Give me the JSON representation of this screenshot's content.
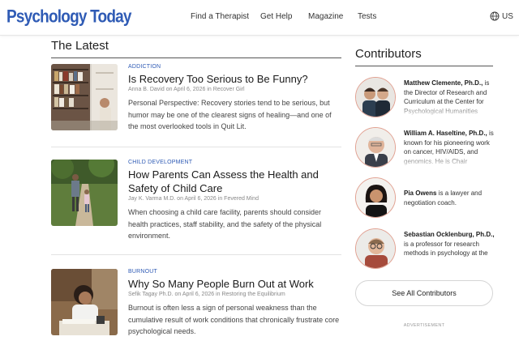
{
  "header": {
    "logo": "Psychology Today",
    "nav": [
      "Find a Therapist",
      "Get Help",
      "Magazine",
      "Tests"
    ],
    "locale": "US"
  },
  "latest": {
    "heading": "The Latest",
    "articles": [
      {
        "category": "ADDICTION",
        "title": "Is Recovery Too Serious to Be Funny?",
        "author": "Anna B. David",
        "date_text": "on April 6, 2026 in",
        "blog": "Recover Girl",
        "teaser": "Personal Perspective: Recovery stories tend to be serious, but humor may be one of the clearest signs of healing—and one of the most overlooked tools in Quit Lit."
      },
      {
        "category": "CHILD DEVELOPMENT",
        "title": "How Parents Can Assess the Health and Safety of Child Care",
        "author": "Jay K. Varma M.D.",
        "date_text": "on April 6, 2026 in",
        "blog": "Fevered Mind",
        "teaser": "When choosing a child care facility, parents should consider health practices, staff stability, and the safety of the physical environment."
      },
      {
        "category": "BURNOUT",
        "title": "Why So Many People Burn Out at Work",
        "author": "Sefik Tagay Ph.D.",
        "date_text": "on April 6, 2026 in",
        "blog": "Restoring the Equilibrium",
        "teaser": "Burnout is often less a sign of personal weakness than the cumulative result of work conditions that chronically frustrate core psychological needs."
      }
    ]
  },
  "contributors": {
    "heading": "Contributors",
    "items": [
      {
        "name": "Matthew Clemente, Ph.D.,",
        "desc": "is the Director of Research and Curriculum at the Center for Psychological Humanities"
      },
      {
        "name": "William A. Haseltine, Ph.D.,",
        "desc": "is known for his pioneering work on cancer, HIV/AIDS, and genomics. He is Chair"
      },
      {
        "name": "Pia Owens",
        "desc": "is a lawyer and negotiation coach."
      },
      {
        "name": "Sebastian Ocklenburg, Ph.D.,",
        "desc": "is a professor for research methods in psychology at the"
      }
    ],
    "see_all": "See All Contributors",
    "advertisement": "ADVERTISEMENT"
  },
  "colors": {
    "brand": "#2f5bb5",
    "avatar_border": "#e1a090"
  }
}
